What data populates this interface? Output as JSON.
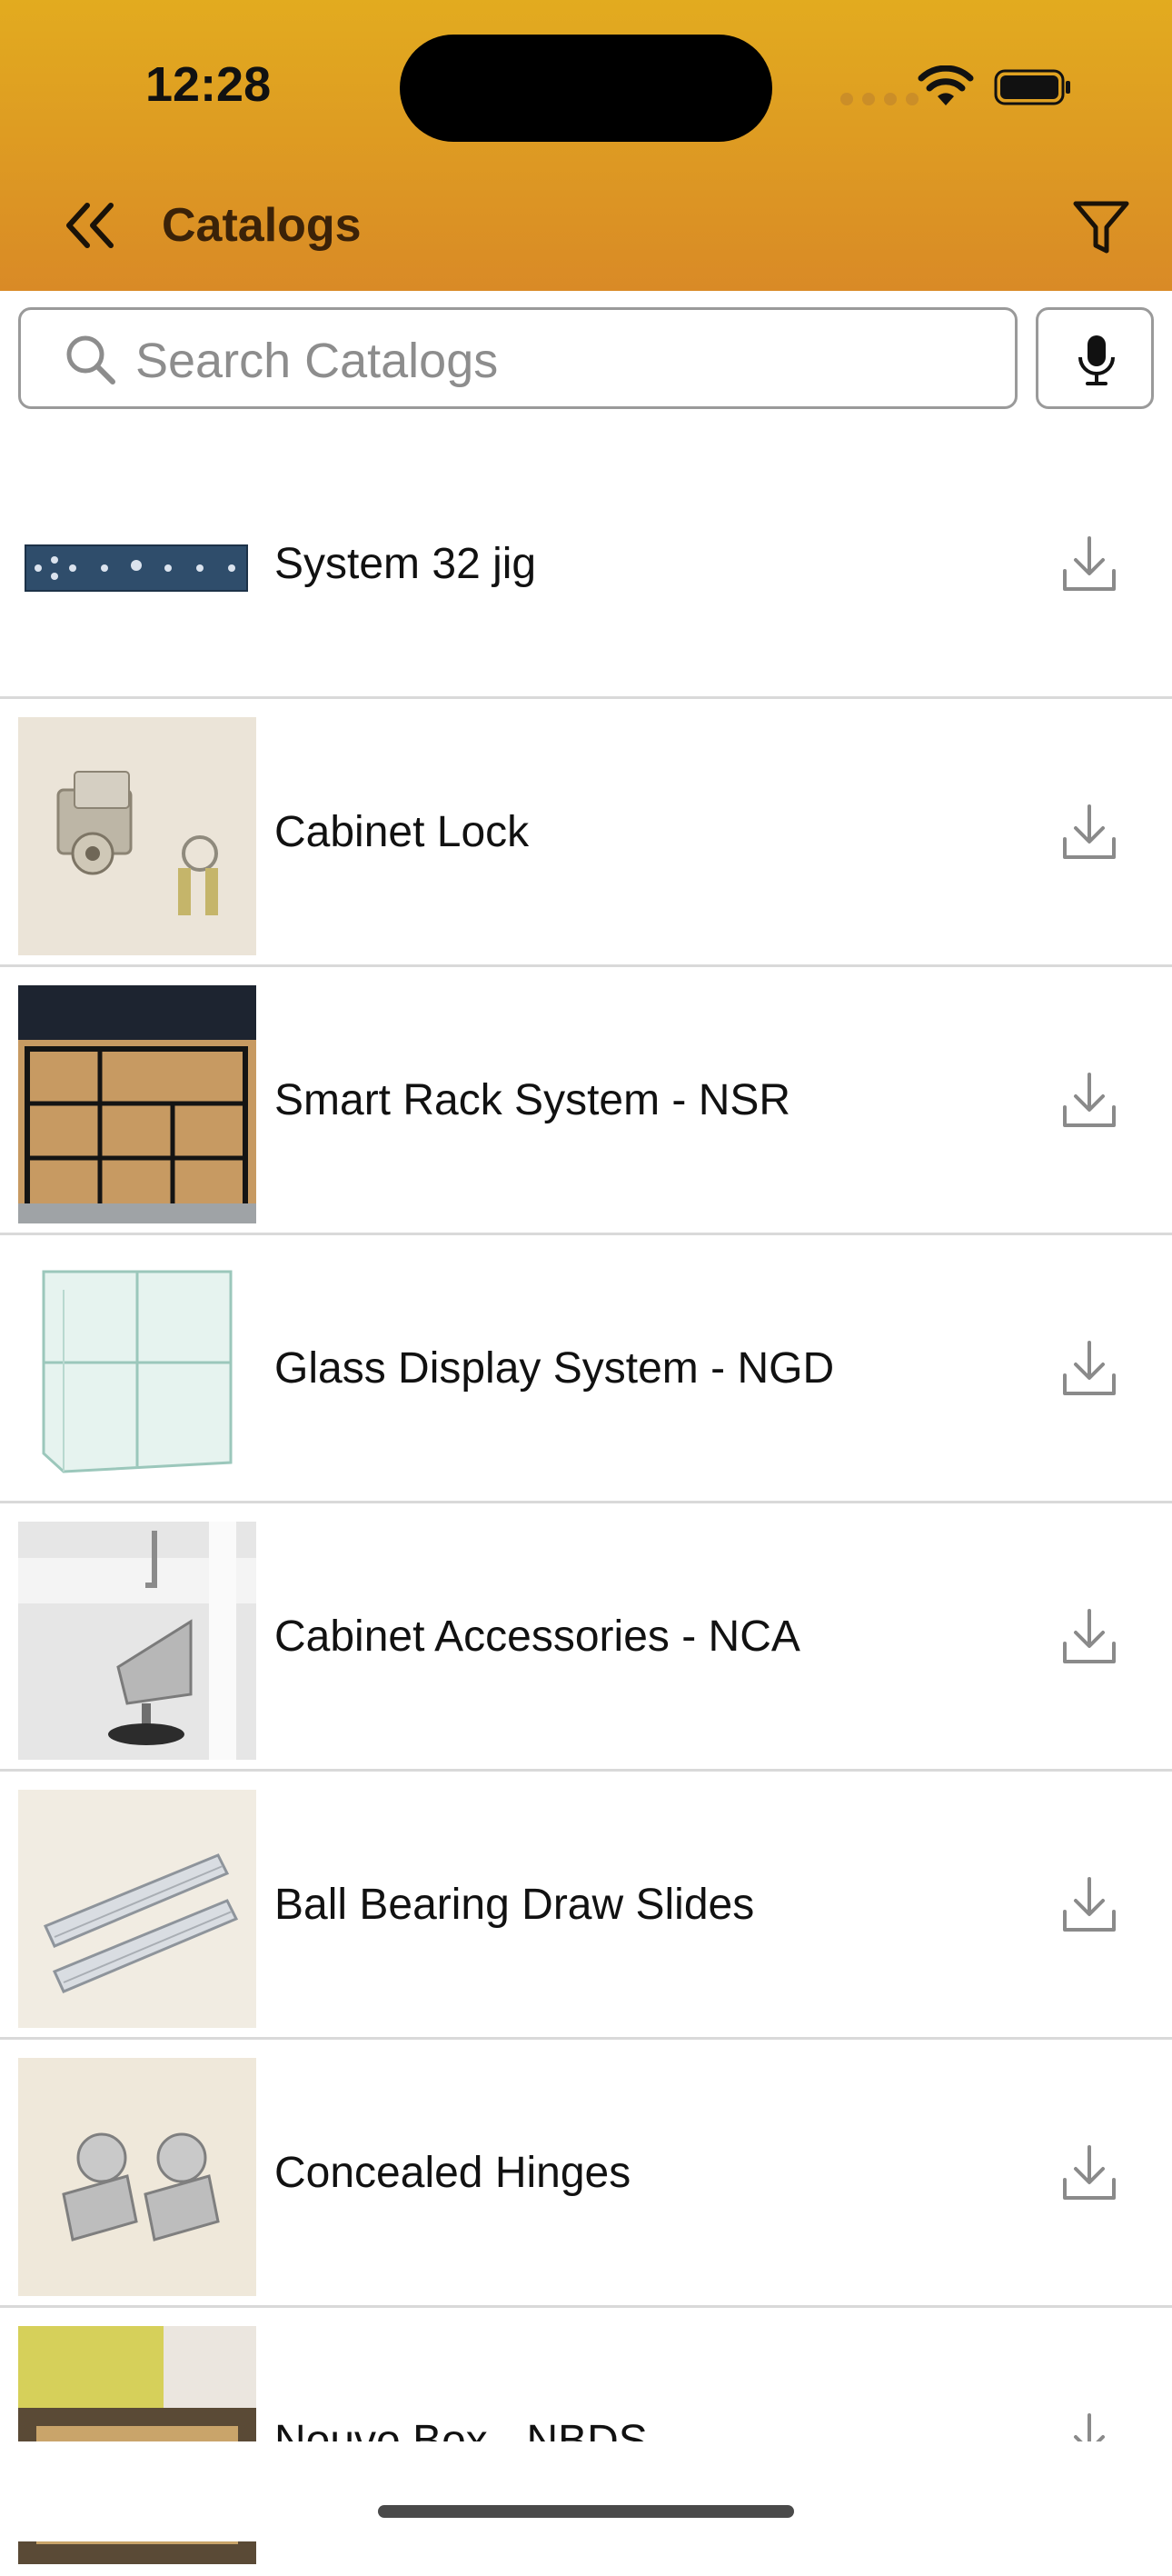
{
  "status_bar": {
    "time": "12:28"
  },
  "header": {
    "title": "Catalogs"
  },
  "search": {
    "placeholder": "Search Catalogs"
  },
  "catalogs": [
    {
      "label": "System 32 jig"
    },
    {
      "label": "Cabinet Lock"
    },
    {
      "label": "Smart Rack System - NSR"
    },
    {
      "label": "Glass Display System - NGD"
    },
    {
      "label": "Cabinet Accessories - NCA"
    },
    {
      "label": "Ball Bearing Draw Slides"
    },
    {
      "label": "Concealed Hinges"
    },
    {
      "label": "Nouvo Box - NBDS"
    }
  ],
  "colors": {
    "header_top": "#e2ab1f",
    "header_bottom": "#d98a26",
    "title": "#3b2208"
  }
}
